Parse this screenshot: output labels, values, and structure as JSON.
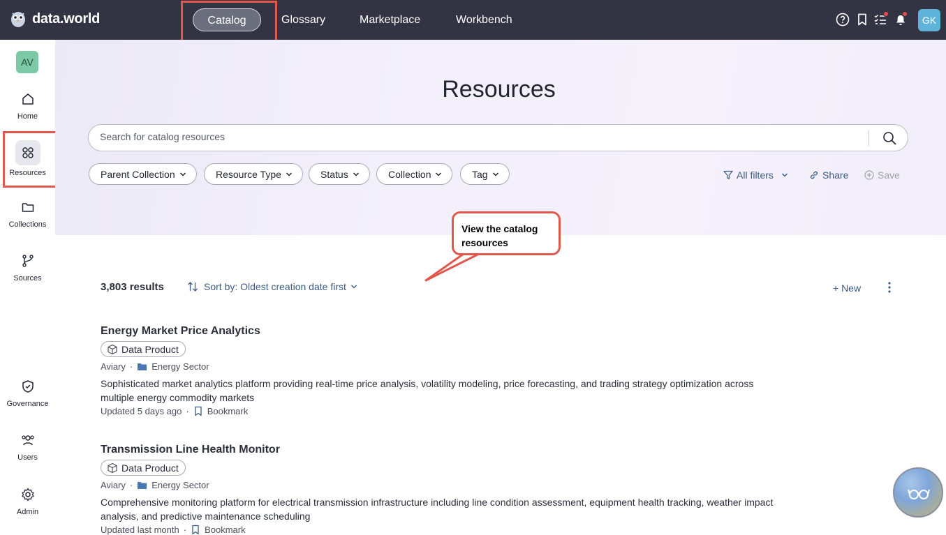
{
  "brand": {
    "name": "data.world"
  },
  "nav": {
    "catalog": "Catalog",
    "glossary": "Glossary",
    "marketplace": "Marketplace",
    "workbench": "Workbench"
  },
  "top_icons": [
    "help-icon",
    "bookmark-icon",
    "tasks-icon",
    "bell-icon"
  ],
  "user": {
    "initials": "GK"
  },
  "sidebar": {
    "avatar": "AV",
    "items": [
      {
        "label": "Home",
        "icon": "home-icon"
      },
      {
        "label": "Resources",
        "icon": "resources-icon",
        "active": true
      },
      {
        "label": "Collections",
        "icon": "folder-icon"
      },
      {
        "label": "Sources",
        "icon": "sources-icon"
      },
      {
        "label": "Governance",
        "icon": "shield-icon"
      },
      {
        "label": "Users",
        "icon": "users-icon"
      },
      {
        "label": "Admin",
        "icon": "gear-icon"
      }
    ]
  },
  "page": {
    "title": "Resources"
  },
  "search": {
    "placeholder": "Search for catalog resources"
  },
  "filters": [
    "Parent Collection",
    "Resource Type",
    "Status",
    "Collection",
    "Tag"
  ],
  "actions": {
    "all_filters": "All filters",
    "share": "Share",
    "save": "Save"
  },
  "callout": {
    "text": "View the catalog resources"
  },
  "results": {
    "count": "3,803 results",
    "sort": "Sort by: Oldest creation date first",
    "new": "+ New",
    "items": [
      {
        "title": "Energy Market Price Analytics",
        "type": "Data Product",
        "owner": "Aviary",
        "collection": "Energy Sector",
        "description": "Sophisticated market analytics platform providing real-time price analysis, volatility modeling, price forecasting, and trading strategy optimization across multiple energy commodity markets",
        "updated": "Updated 5 days ago",
        "bookmark": "Bookmark"
      },
      {
        "title": "Transmission Line Health Monitor",
        "type": "Data Product",
        "owner": "Aviary",
        "collection": "Energy Sector",
        "description": "Comprehensive monitoring platform for electrical transmission infrastructure including line condition assessment, equipment health tracking, weather impact analysis, and predictive maintenance scheduling",
        "updated": "Updated last month",
        "bookmark": "Bookmark"
      }
    ]
  },
  "colors": {
    "topbar": "#323443",
    "accent_link": "#3b5b84",
    "highlight": "#e2574c"
  }
}
